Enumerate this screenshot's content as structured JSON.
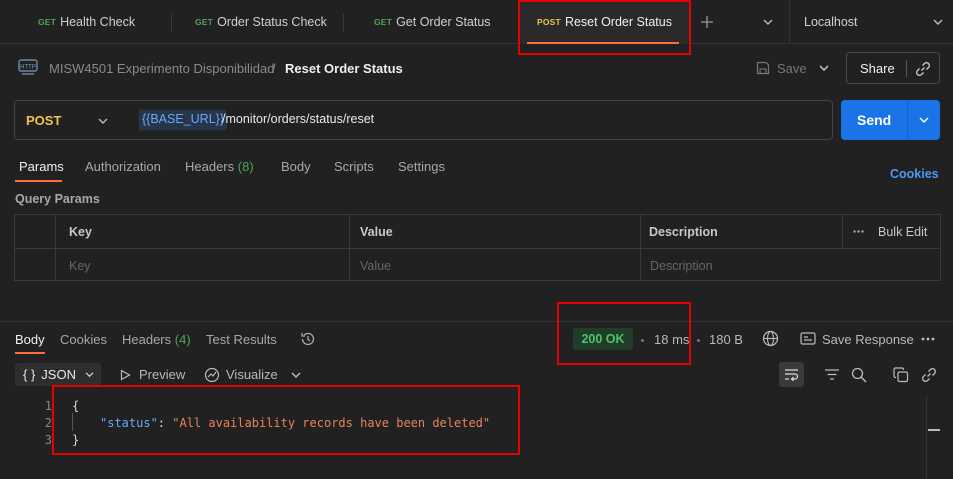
{
  "tabs": [
    {
      "method": "GET",
      "label": "Health Check"
    },
    {
      "method": "GET",
      "label": "Order Status Check"
    },
    {
      "method": "GET",
      "label": "Get Order Status"
    },
    {
      "method": "POST",
      "label": "Reset Order Status"
    }
  ],
  "environment": "Localhost",
  "breadcrumb": {
    "collection": "MISW4501 Experimento Disponibilidad",
    "separator": "/",
    "request": "Reset Order Status"
  },
  "toolbar": {
    "save_label": "Save",
    "share_label": "Share"
  },
  "request": {
    "method": "POST",
    "url_variable": "{{BASE_URL}}",
    "url_path": "/monitor/orders/status/reset",
    "send_label": "Send"
  },
  "request_tabs": {
    "params": "Params",
    "authorization": "Authorization",
    "headers": "Headers",
    "headers_count": "(8)",
    "body": "Body",
    "scripts": "Scripts",
    "settings": "Settings",
    "cookies": "Cookies"
  },
  "query_params": {
    "title": "Query Params",
    "columns": {
      "key": "Key",
      "value": "Value",
      "description": "Description",
      "bulk_edit": "Bulk Edit"
    },
    "placeholders": {
      "key": "Key",
      "value": "Value",
      "description": "Description"
    }
  },
  "response": {
    "tabs": {
      "body": "Body",
      "cookies": "Cookies",
      "headers": "Headers",
      "headers_count": "(4)",
      "test_results": "Test Results"
    },
    "status": "200 OK",
    "time": "18 ms",
    "size": "180 B",
    "save_response": "Save Response",
    "format": "JSON",
    "preview": "Preview",
    "visualize": "Visualize",
    "code_lines": [
      {
        "num": "1",
        "text": "{"
      },
      {
        "num": "2",
        "key": "\"status\"",
        "colon": ": ",
        "value": "\"All availability records have been deleted\""
      },
      {
        "num": "3",
        "text": "}"
      }
    ]
  },
  "colors": {
    "accent": "#ff6c37",
    "send": "#1b73e8",
    "get": "#4ea35a",
    "post": "#f0c44a",
    "status_ok": "#4ec26b",
    "highlight": "#e60000"
  }
}
